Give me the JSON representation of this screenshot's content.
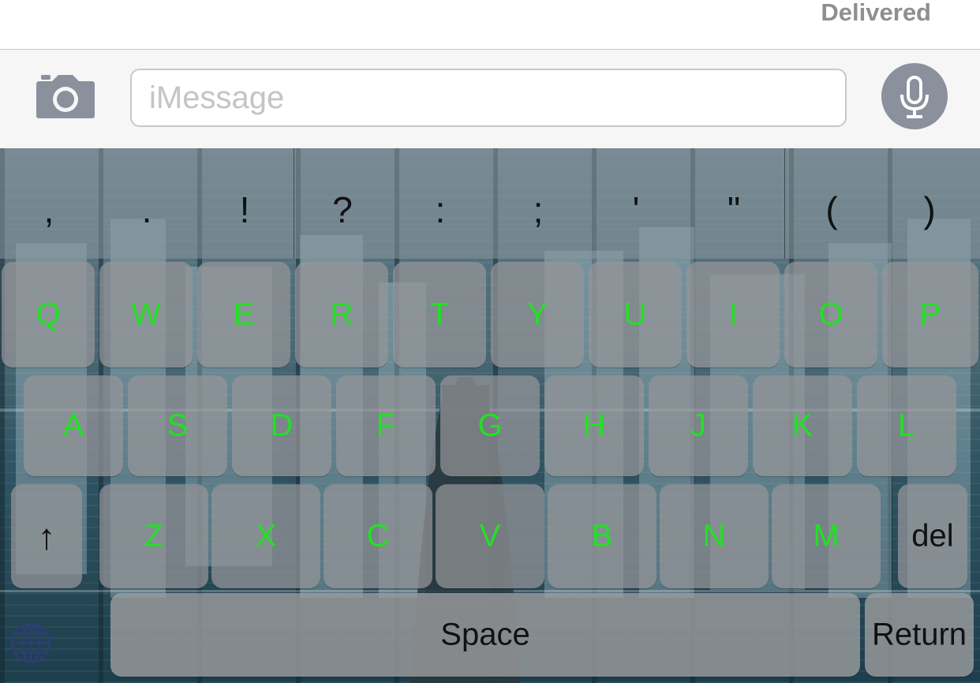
{
  "status": {
    "delivered": "Delivered"
  },
  "input": {
    "placeholder": "iMessage",
    "value": ""
  },
  "icons": {
    "camera": "camera-icon",
    "microphone": "microphone-icon",
    "globe": "globe-icon",
    "shift": "shift-arrow-icon"
  },
  "keyboard": {
    "punctuation": [
      ",",
      ".",
      "!",
      "?",
      ":",
      ";",
      "'",
      "\"",
      "(",
      ")"
    ],
    "row1": [
      "Q",
      "W",
      "E",
      "R",
      "T",
      "Y",
      "U",
      "I",
      "O",
      "P"
    ],
    "row2": [
      "A",
      "S",
      "D",
      "F",
      "G",
      "H",
      "J",
      "K",
      "L"
    ],
    "row3": [
      "Z",
      "X",
      "C",
      "V",
      "B",
      "N",
      "M"
    ],
    "shift_label": "↑",
    "delete_label": "del",
    "space_label": "Space",
    "return_label": "Return"
  },
  "colors": {
    "letter_key_text": "#23e024",
    "mic_button": "#8a909c",
    "delivered_text": "#8e8e93"
  }
}
